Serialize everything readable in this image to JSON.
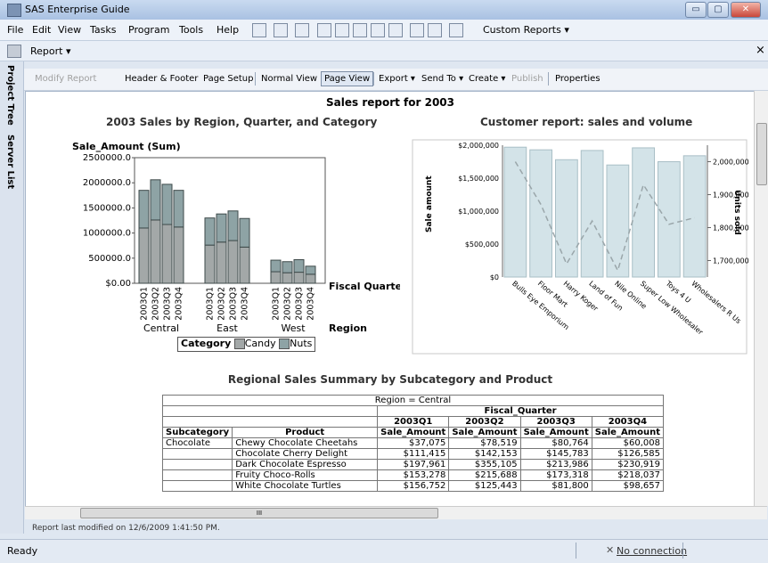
{
  "window": {
    "title": "SAS Enterprise Guide",
    "min_glyph": "▭",
    "max_glyph": "▢",
    "close_glyph": "✕"
  },
  "menubar": {
    "items": [
      "File",
      "Edit",
      "View",
      "Tasks",
      "Program",
      "Tools",
      "Help"
    ],
    "custom_reports": "Custom Reports ▾"
  },
  "report_tab": {
    "label": "Report ▾",
    "close": "×"
  },
  "side_tabs": {
    "project_tree": "Project Tree",
    "server_list": "Server List"
  },
  "report_toolbar": {
    "modify_report": "Modify Report",
    "header_footer": "Header & Footer",
    "page_setup": "Page Setup",
    "normal_view": "Normal View",
    "page_view": "Page View",
    "export": "Export ▾",
    "send_to": "Send To ▾",
    "create": "Create ▾",
    "publish": "Publish",
    "properties": "Properties"
  },
  "report": {
    "title": "Sales report for 2003",
    "left_chart": {
      "title": "2003 Sales by Region, Quarter, and Category",
      "ylabel": "Sale_Amount (Sum)",
      "xlabel": "Fiscal Quarter",
      "group_label": "Region",
      "legend_title": "Category",
      "yticks": [
        "2500000.0",
        "2000000.0",
        "1500000.0",
        "1000000.0",
        "500000.0",
        "$0.00"
      ]
    },
    "right_chart": {
      "title": "Customer report: sales and volume",
      "ylabel_left": "Sale amount",
      "ylabel_right": "Units sold",
      "yticks_left": [
        "$2,000,000",
        "$1,500,000",
        "$1,000,000",
        "$500,000",
        "$0"
      ],
      "yticks_right": [
        "2,000,000",
        "1,900,000",
        "1,800,000",
        "1,700,000"
      ]
    },
    "table": {
      "title": "Regional Sales Summary by Subcategory and Product",
      "region": "Region = Central",
      "fiscal_quarter": "Fiscal_Quarter",
      "quarters": [
        "2003Q1",
        "2003Q2",
        "2003Q3",
        "2003Q4"
      ],
      "col_subcategory": "Subcategory",
      "col_product": "Product",
      "measure": "Sale_Amount",
      "rows": [
        {
          "subcategory": "Chocolate",
          "product": "Chewy Chocolate Cheetahs",
          "values": [
            "$37,075",
            "$78,519",
            "$80,764",
            "$60,008"
          ]
        },
        {
          "subcategory": "",
          "product": "Chocolate Cherry Delight",
          "values": [
            "$111,415",
            "$142,153",
            "$145,783",
            "$126,585"
          ]
        },
        {
          "subcategory": "",
          "product": "Dark Chocolate Espresso",
          "values": [
            "$197,961",
            "$355,105",
            "$213,986",
            "$230,919"
          ]
        },
        {
          "subcategory": "",
          "product": "Fruity Choco-Rolls",
          "values": [
            "$153,278",
            "$215,688",
            "$173,318",
            "$218,037"
          ]
        },
        {
          "subcategory": "",
          "product": "White Chocolate Turtles",
          "values": [
            "$156,752",
            "$125,443",
            "$81,800",
            "$98,657"
          ]
        }
      ]
    }
  },
  "chart_data": [
    {
      "type": "bar",
      "title": "2003 Sales by Region, Quarter, and Category",
      "ylabel": "Sale_Amount (Sum)",
      "xlabel": "Fiscal Quarter",
      "group_label": "Region",
      "ylim": [
        0,
        2500000
      ],
      "stacked": true,
      "groups": [
        "Central",
        "East",
        "West"
      ],
      "categories": [
        "2003Q1",
        "2003Q2",
        "2003Q3",
        "2003Q4"
      ],
      "series": [
        {
          "name": "Candy",
          "values": [
            [
              1100000,
              1260000,
              1170000,
              1120000
            ],
            [
              760000,
              820000,
              850000,
              720000
            ],
            [
              230000,
              210000,
              220000,
              180000
            ]
          ]
        },
        {
          "name": "Nuts",
          "values": [
            [
              750000,
              800000,
              800000,
              730000
            ],
            [
              540000,
              560000,
              590000,
              570000
            ],
            [
              230000,
              220000,
              250000,
              160000
            ]
          ]
        }
      ],
      "colors": {
        "Candy": "#a3a8a8",
        "Nuts": "#8ea3a5"
      }
    },
    {
      "type": "bar",
      "title": "Customer report: sales and volume",
      "ylabel": "Sale amount",
      "y2label": "Units sold",
      "ylim": [
        0,
        2000000
      ],
      "y2lim": [
        1650000,
        2050000
      ],
      "categories": [
        "Bulls Eye Emporium",
        "Floor Mart",
        "Harry Koger",
        "Land of Fun",
        "Nile Online",
        "Super Low Wholesaler",
        "Toys 4 U",
        "Wholesalers R Us"
      ],
      "series": [
        {
          "name": "Sale amount",
          "values": [
            1970000,
            1930000,
            1780000,
            1920000,
            1700000,
            1960000,
            1750000,
            1840000
          ]
        },
        {
          "name": "Units sold",
          "type": "line",
          "values": [
            2000000,
            1870000,
            1690000,
            1820000,
            1670000,
            1930000,
            1810000,
            1830000
          ]
        }
      ],
      "colors": {
        "bar": "#d3e3e8",
        "line": "#9aa6aa"
      }
    }
  ],
  "scroll": {
    "hthumb": "III"
  },
  "footer": {
    "modified": "Report last modified on 12/6/2009 1:41:50 PM."
  },
  "status": {
    "ready": "Ready",
    "connection": "No connection"
  }
}
